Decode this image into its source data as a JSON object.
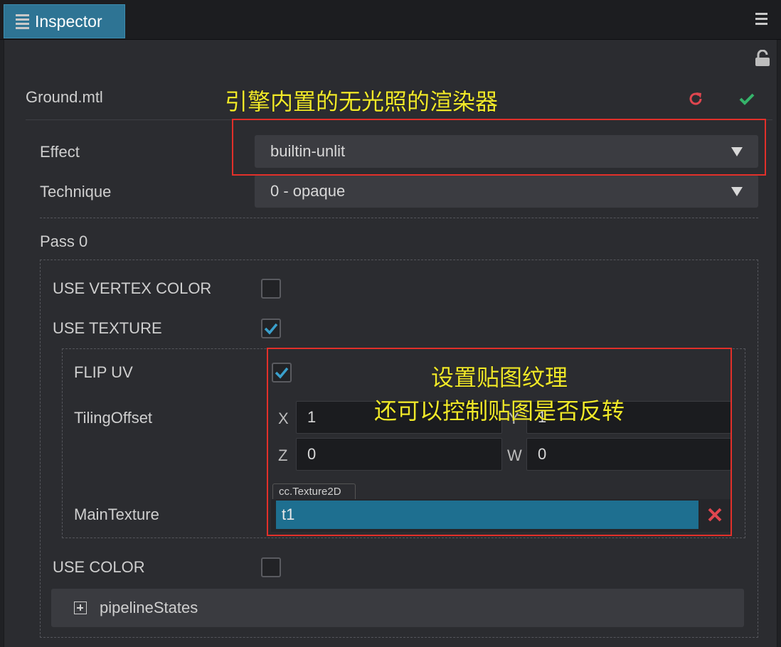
{
  "window": {
    "tab_label": "Inspector"
  },
  "inspector": {
    "asset_name": "Ground.mtl",
    "effect": {
      "label": "Effect",
      "value": "builtin-unlit"
    },
    "technique": {
      "label": "Technique",
      "value": "0 - opaque"
    },
    "pass_title": "Pass 0",
    "use_vertex_color": {
      "label": "USE VERTEX COLOR",
      "checked": false
    },
    "use_texture": {
      "label": "USE TEXTURE",
      "checked": true
    },
    "flip_uv": {
      "label": "FLIP UV",
      "checked": true
    },
    "tiling_offset": {
      "label": "TilingOffset",
      "x_axis": "X",
      "x": "1",
      "y_axis": "Y",
      "y": "1",
      "z_axis": "Z",
      "z": "0",
      "w_axis": "W",
      "w": "0"
    },
    "main_texture": {
      "label": "MainTexture",
      "type": "cc.Texture2D",
      "value": "t1"
    },
    "use_color": {
      "label": "USE COLOR",
      "checked": false
    },
    "pipeline_states": "pipelineStates"
  },
  "annotations": {
    "effect_note": "引擎内置的无光照的渲染器",
    "texture_note_line1": "设置贴图纹理",
    "texture_note_line2": "还可以控制贴图是否反转"
  },
  "colors": {
    "tab_active": "#2e7494",
    "texture_field": "#1e6f90",
    "revert": "#e0464f",
    "apply": "#35b36a",
    "annotation_box": "#e2302a",
    "annotation_text": "#f0e82a"
  },
  "icons": {
    "tab": "document-icon",
    "menu": "hamburger-menu-icon",
    "lock": "unlock-icon",
    "revert": "revert-icon",
    "apply": "check-icon",
    "dropdown": "triangle-down-icon",
    "clear": "close-icon",
    "expand": "plus-box-icon"
  }
}
